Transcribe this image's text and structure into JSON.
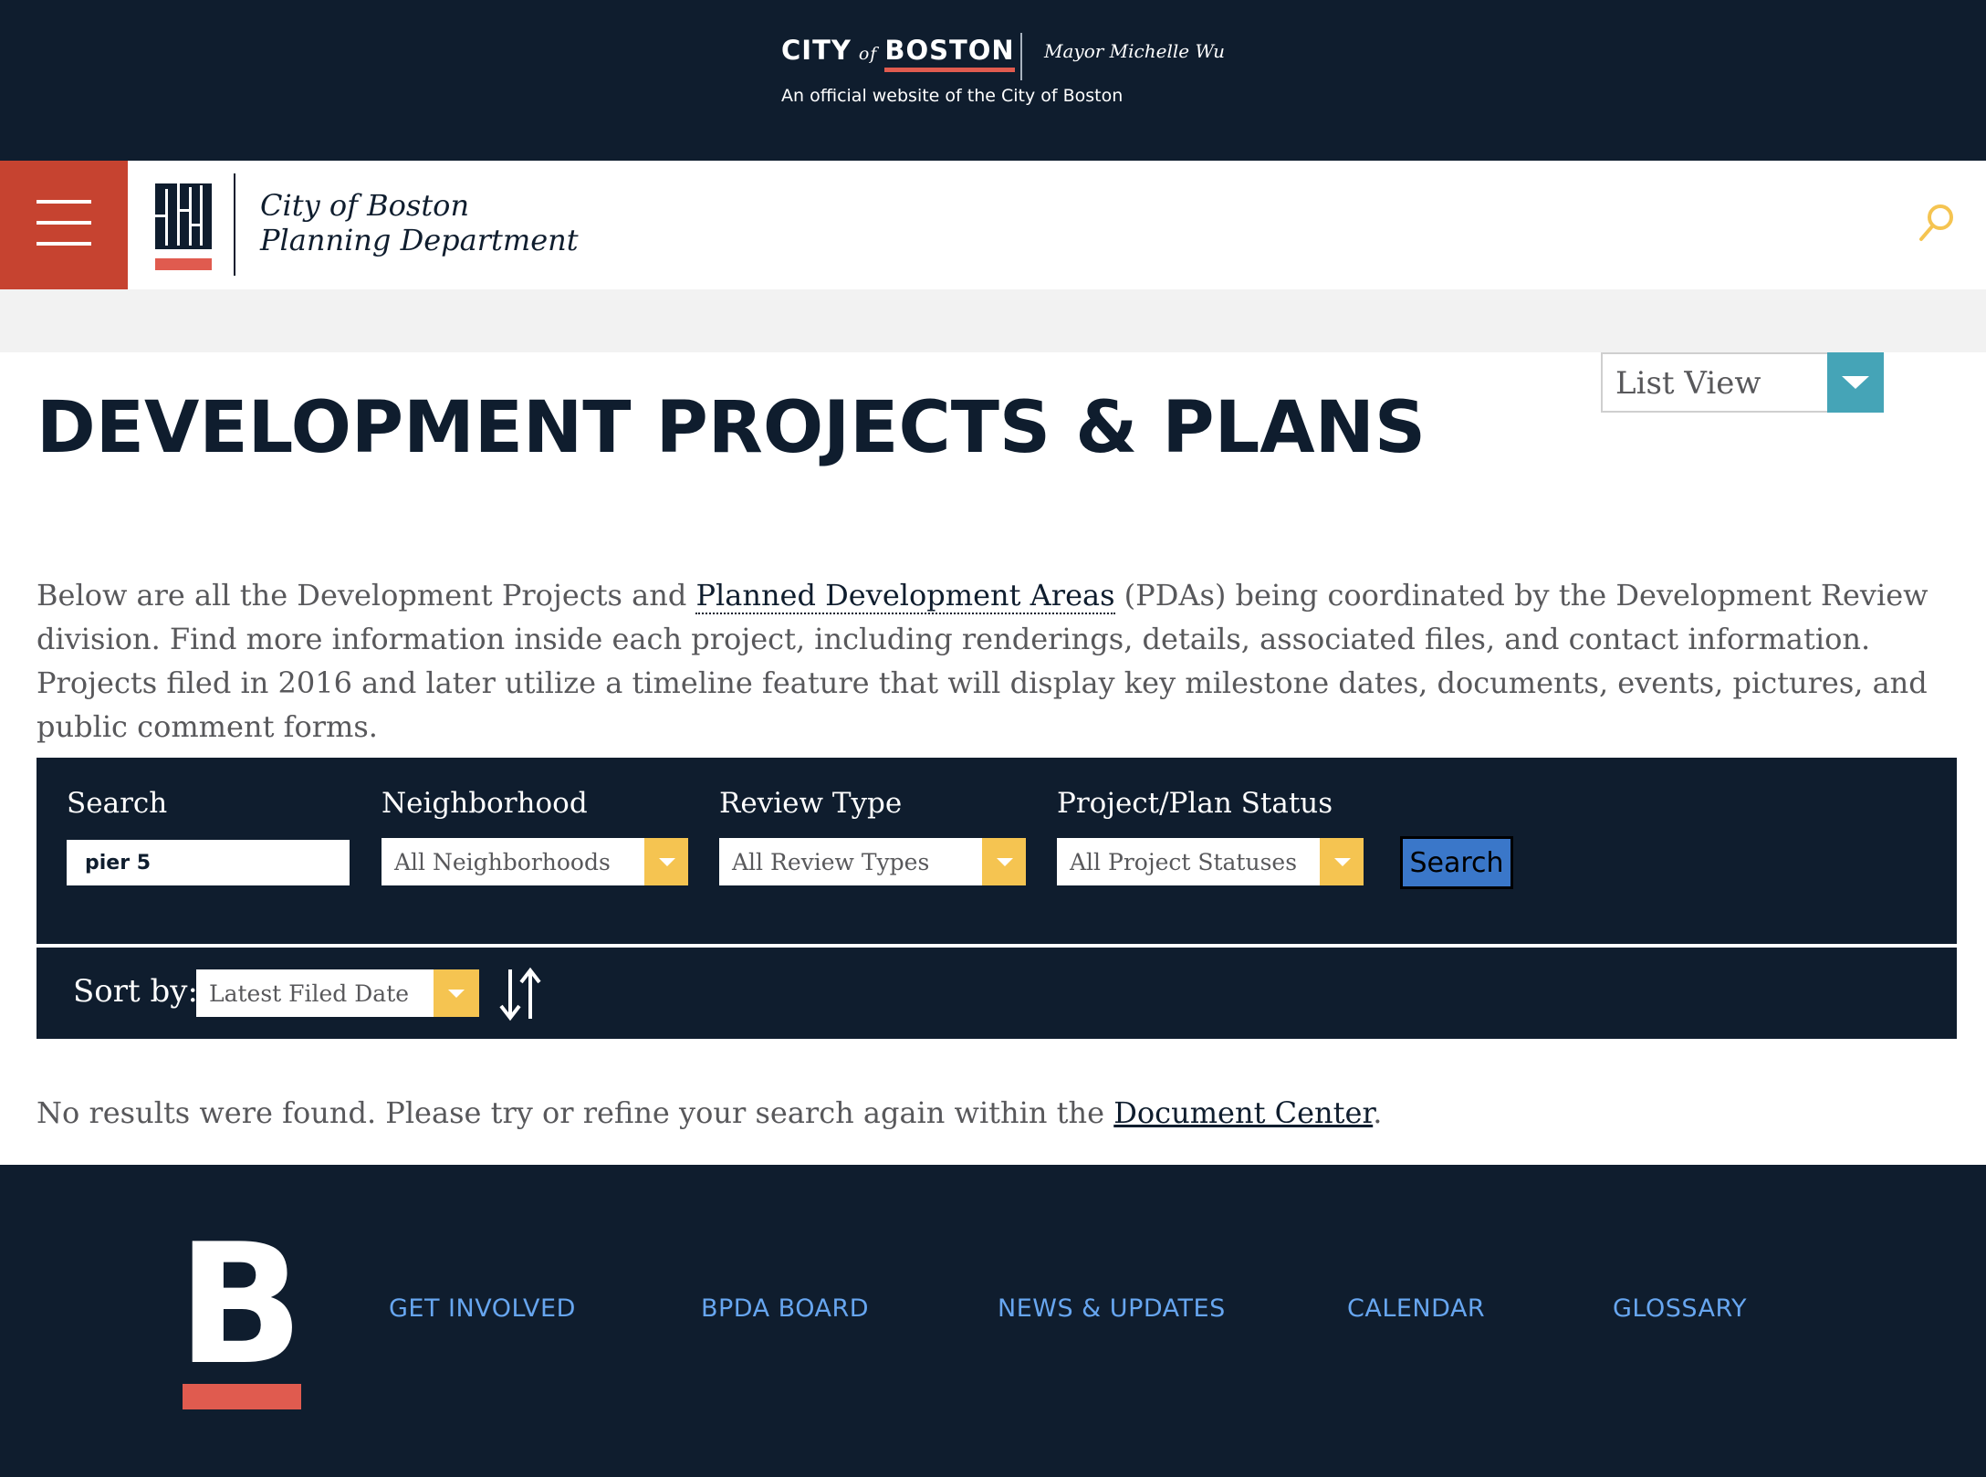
{
  "banner": {
    "city_word": "CITY",
    "of_word": "of",
    "boston_word": "BOSTON",
    "mayor": "Mayor Michelle Wu",
    "official": "An official website of the City of Boston"
  },
  "header": {
    "brand_line1": "City of Boston",
    "brand_line2": "Planning Department",
    "menu_icon": "hamburger-menu-icon",
    "search_icon": "search-icon"
  },
  "view_select": {
    "selected": "List View"
  },
  "page": {
    "title": "DEVELOPMENT PROJECTS & PLANS",
    "intro_before_link": "Below are all the Development Projects and ",
    "intro_link": "Planned Development Areas",
    "intro_after_link": " (PDAs) being coordinated by the Development Review division. Find more information inside each project, including renderings, details, associated files, and contact information. Projects filed in 2016 and later utilize a timeline feature that will display key milestone dates, documents, events, pictures, and public comment forms."
  },
  "filters": {
    "search_label": "Search",
    "search_value": "pier 5",
    "neighborhood_label": "Neighborhood",
    "neighborhood_value": "All Neighborhoods",
    "review_type_label": "Review Type",
    "review_type_value": "All Review Types",
    "status_label": "Project/Plan Status",
    "status_value": "All Project Statuses",
    "search_button": "Search"
  },
  "sort": {
    "label": "Sort by:",
    "value": "Latest Filed Date",
    "direction_icon": "sort-direction-icon"
  },
  "results": {
    "message_before_link": "No results were found. Please try or refine your search again within the ",
    "link": "Document Center",
    "message_after_link": "."
  },
  "footer": {
    "logo_letter": "B",
    "nav": [
      "GET INVOLVED",
      "BPDA BOARD",
      "NEWS & UPDATES",
      "CALENDAR",
      "GLOSSARY"
    ]
  },
  "colors": {
    "navy": "#0f1d2e",
    "red": "#c64330",
    "teal": "#45a4b7",
    "yellow": "#f5c451",
    "button_blue": "#3a77c9",
    "footer_link": "#67a6f0"
  }
}
